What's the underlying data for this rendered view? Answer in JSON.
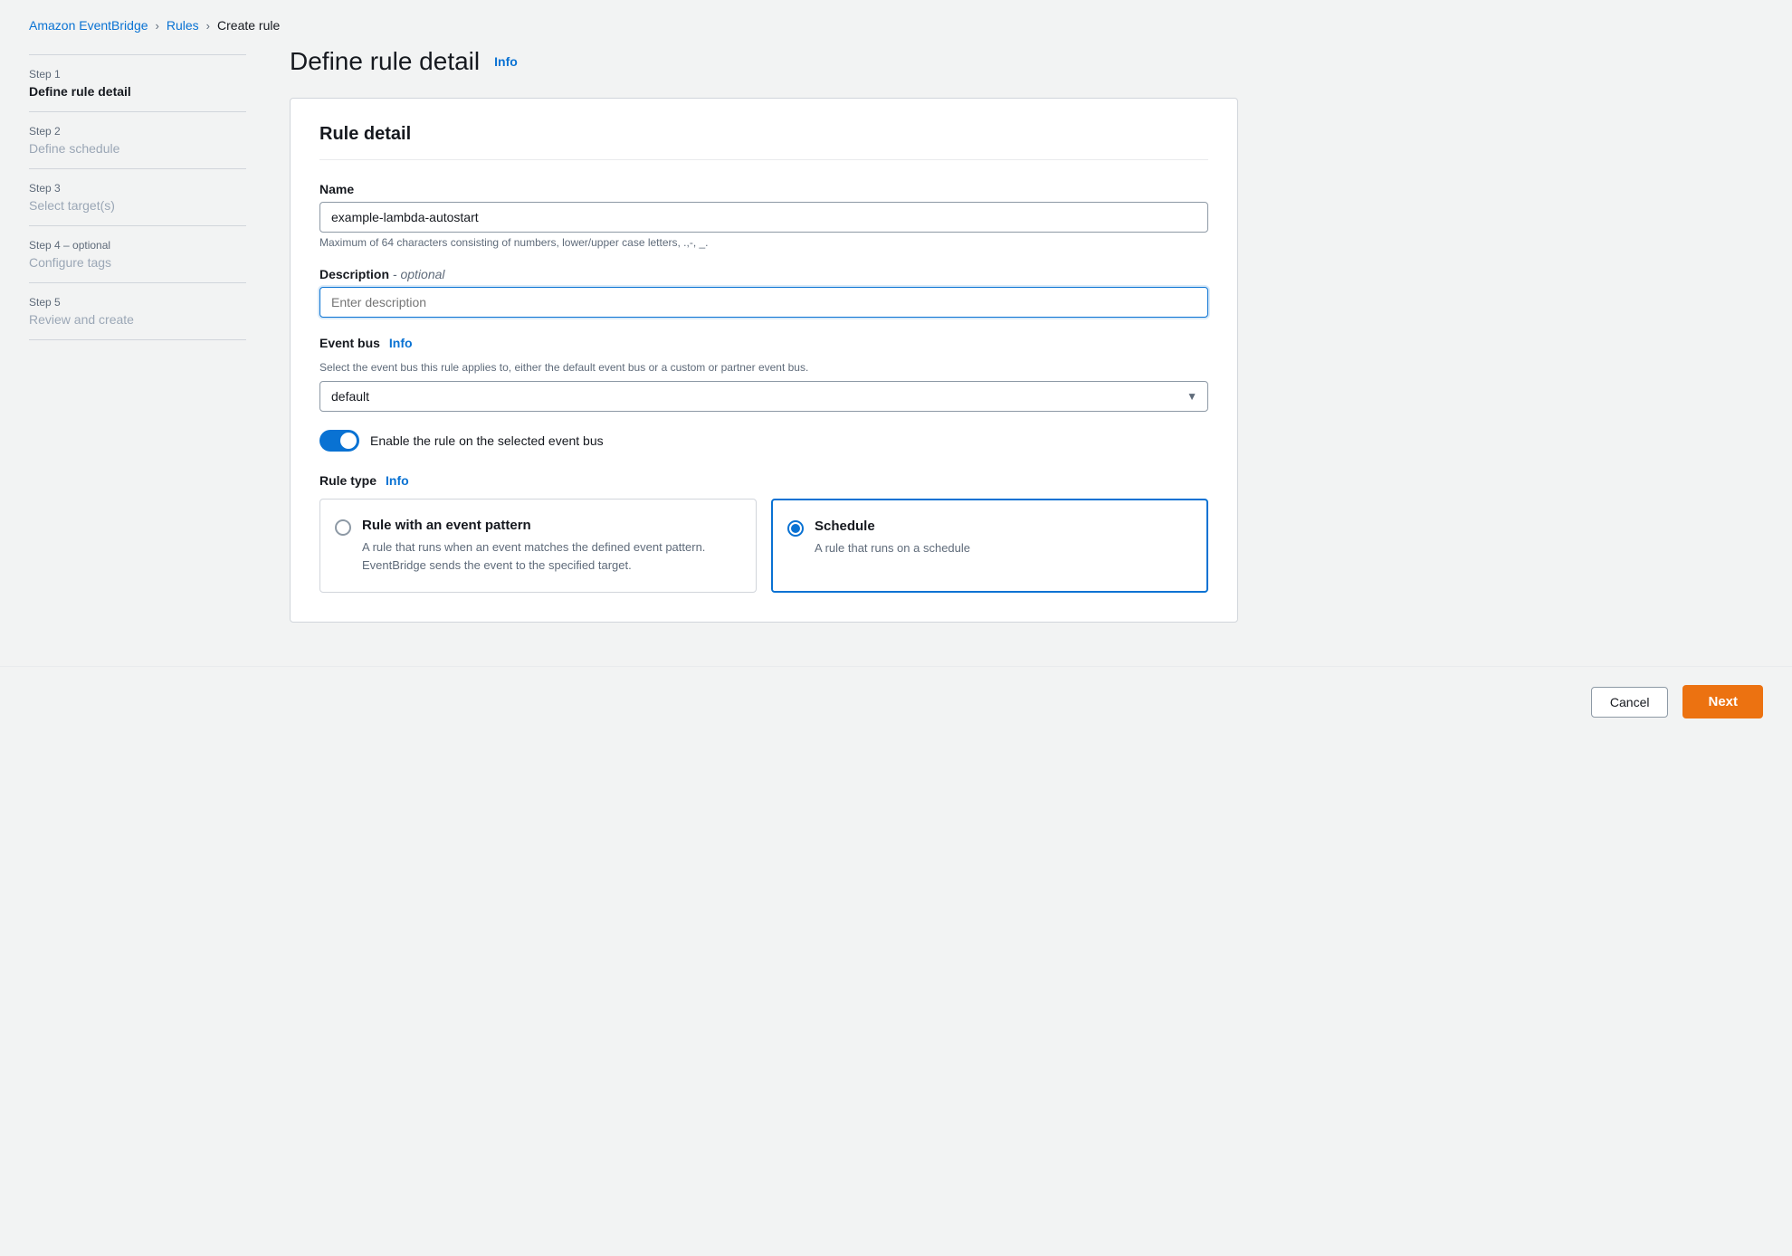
{
  "breadcrumb": {
    "root": "Amazon EventBridge",
    "parent": "Rules",
    "current": "Create rule"
  },
  "sidebar": {
    "steps": [
      {
        "number": "Step 1",
        "name": "Define rule detail",
        "active": true
      },
      {
        "number": "Step 2",
        "name": "Define schedule",
        "active": false
      },
      {
        "number": "Step 3",
        "name": "Select target(s)",
        "active": false
      },
      {
        "number": "Step 4 – optional",
        "name": "Configure tags",
        "active": false
      },
      {
        "number": "Step 5",
        "name": "Review and create",
        "active": false
      }
    ]
  },
  "page": {
    "title": "Define rule detail",
    "info_link": "Info"
  },
  "card": {
    "title": "Rule detail"
  },
  "form": {
    "name_label": "Name",
    "name_value": "example-lambda-autostart",
    "name_hint": "Maximum of 64 characters consisting of numbers, lower/upper case letters, .,-, _.",
    "description_label": "Description",
    "description_optional": "- optional",
    "description_placeholder": "Enter description",
    "event_bus_label": "Event bus",
    "event_bus_info": "Info",
    "event_bus_hint": "Select the event bus this rule applies to, either the default event bus or a custom or partner event bus.",
    "event_bus_value": "default",
    "toggle_label": "Enable the rule on the selected event bus",
    "rule_type_label": "Rule type",
    "rule_type_info": "Info",
    "rule_types": [
      {
        "id": "event_pattern",
        "title": "Rule with an event pattern",
        "description": "A rule that runs when an event matches the defined event pattern. EventBridge sends the event to the specified target.",
        "selected": false
      },
      {
        "id": "schedule",
        "title": "Schedule",
        "description": "A rule that runs on a schedule",
        "selected": true
      }
    ]
  },
  "footer": {
    "cancel_label": "Cancel",
    "next_label": "Next"
  }
}
